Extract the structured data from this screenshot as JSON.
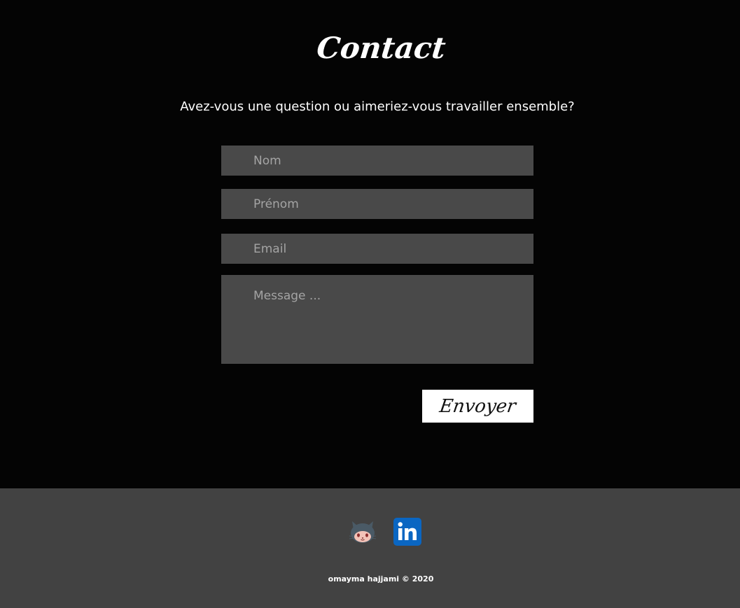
{
  "contact": {
    "title": "Contact",
    "subtitle": "Avez-vous une question ou aimeriez-vous travailler ensemble?"
  },
  "form": {
    "nom_placeholder": "Nom",
    "prenom_placeholder": "Prénom",
    "email_placeholder": "Email",
    "message_placeholder": "Message ...",
    "submit_label": "Envoyer"
  },
  "footer": {
    "social": [
      {
        "icon": "github-octocat-icon"
      },
      {
        "icon": "linkedin-icon"
      }
    ],
    "copyright": "omayma hajjami © 2020"
  },
  "colors": {
    "background": "#040404",
    "footer_background": "#424242",
    "field_background": "#494949",
    "linkedin_blue": "#0a66c2",
    "button_background": "#ffffff"
  }
}
